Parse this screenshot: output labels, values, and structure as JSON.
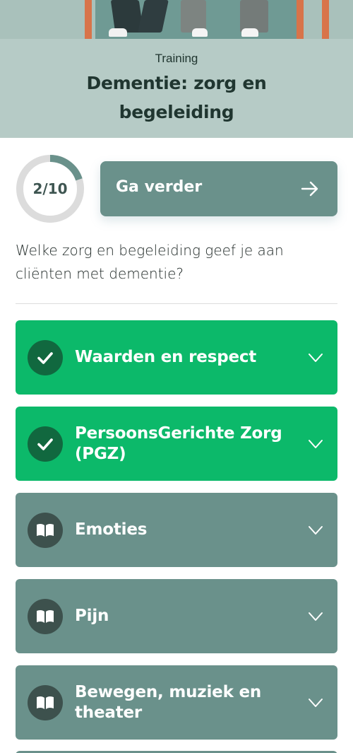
{
  "header": {
    "kicker": "Training",
    "title": "Dementie: zorg en begeleiding"
  },
  "progress": {
    "label": "2/10",
    "completed": 2,
    "total": 10
  },
  "cta": {
    "label": "Ga verder",
    "icon": "arrow-right-icon"
  },
  "question": "Welke zorg en begeleiding geef je aan cliënten met dementie?",
  "modules": [
    {
      "title": "Waarden en respect",
      "status": "completed",
      "icon": "check-icon"
    },
    {
      "title": "PersoonsGerichte Zorg (PGZ)",
      "status": "completed",
      "icon": "check-icon"
    },
    {
      "title": "Emoties",
      "status": "not-started",
      "icon": "book-icon"
    },
    {
      "title": "Pijn",
      "status": "not-started",
      "icon": "book-icon"
    },
    {
      "title": "Bewegen, muziek en theater",
      "status": "not-started",
      "icon": "book-icon"
    }
  ],
  "colors": {
    "completed": "#0cb96a",
    "completed_badge": "#11683f",
    "pending": "#6a918b",
    "pending_badge": "#3d514d",
    "header_bg": "#b6cbc6",
    "progress_track": "#dcdcdc",
    "progress_fill": "#6a918b"
  }
}
